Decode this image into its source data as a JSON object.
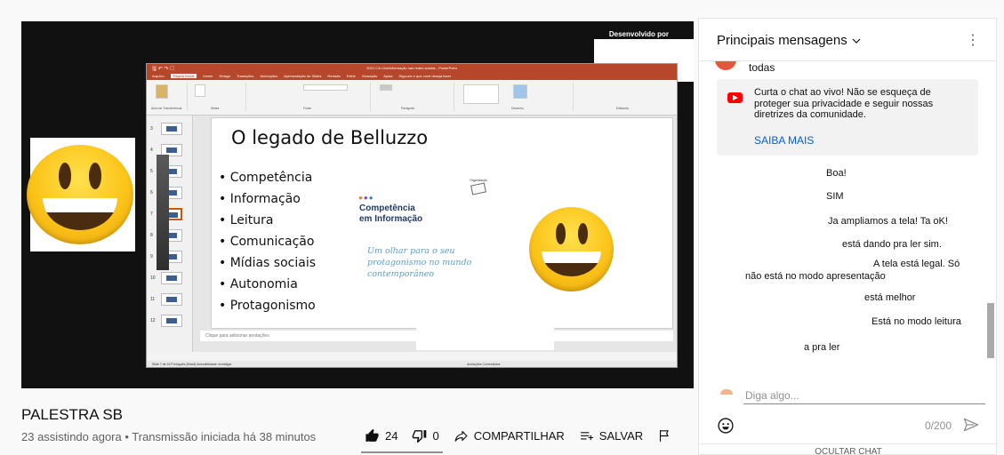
{
  "player": {
    "overlay_label": "Desenvolvido por",
    "ppt": {
      "window_title": "2021 CA-ChatInformação nas redes sociais  -  PowerPoint",
      "tabs": [
        "Arquivo",
        "Página Inicial",
        "Inserir",
        "Design",
        "Transições",
        "Animações",
        "Apresentação de Slides",
        "Revisão",
        "Exibir",
        "Gravação",
        "Ajuda",
        "Diga-me o que você deseja fazer"
      ],
      "active_tab": "Página Inicial",
      "ribbon_groups": [
        "Área de Transferência",
        "Slides",
        "Fonte",
        "Parágrafo",
        "Desenho",
        "Editando"
      ],
      "slide_title": "O legado de Belluzzo",
      "bullets": [
        "Competência",
        "Informação",
        "Leitura",
        "Comunicação",
        "Mídias sociais",
        "Autonomia",
        "Protagonismo"
      ],
      "logo_line1": "Competência",
      "logo_line2": "em Informação",
      "quote": "Um olhar para o seu protagonismo no mundo contemporâneo",
      "org_label": "Organização",
      "notes_placeholder": "Clique para adicionar anotações",
      "status_left": "Slide 7 de 16     Português (Brasil)     Acessibilidade: investigar",
      "status_right": "Anotações     Comentários",
      "thumb_numbers": [
        "3",
        "4",
        "5",
        "6",
        "7",
        "8",
        "9",
        "10",
        "11",
        "12"
      ]
    }
  },
  "video": {
    "title": "PALESTRA SB",
    "meta": "23 assistindo agora • Transmissão iniciada há 38 minutos",
    "likes": "24",
    "dislikes": "0",
    "share_label": "COMPARTILHAR",
    "save_label": "SALVAR"
  },
  "chat": {
    "title": "Principais mensagens",
    "top_fragment": "todas",
    "notice": {
      "text": "Curta o chat ao vivo! Não se esqueça de proteger sua privacidade e seguir nossas diretrizes da comunidade.",
      "link": "SAIBA MAIS"
    },
    "messages": [
      "Boa!",
      "SIM",
      "Ja ampliamos a tela! Ta oK!",
      "está dando pra ler sim.",
      "A tela está legal. Só",
      "não está no modo apresentação",
      "está melhor",
      "Está no modo leitura",
      "a pra ler"
    ],
    "input_placeholder": "Diga algo...",
    "counter": "0/200",
    "hide_label": "OCULTAR CHAT"
  },
  "icons": {
    "like": "thumbs-up-icon",
    "dislike": "thumbs-down-icon",
    "share": "share-icon",
    "save": "playlist-add-icon",
    "report": "flag-icon",
    "chat_menu": "more-vert-icon",
    "emoji": "emoji-icon",
    "send": "send-icon"
  },
  "colors": {
    "brand_red": "#ff0000",
    "link_blue": "#065fd4",
    "ppt_red": "#b7472a"
  }
}
